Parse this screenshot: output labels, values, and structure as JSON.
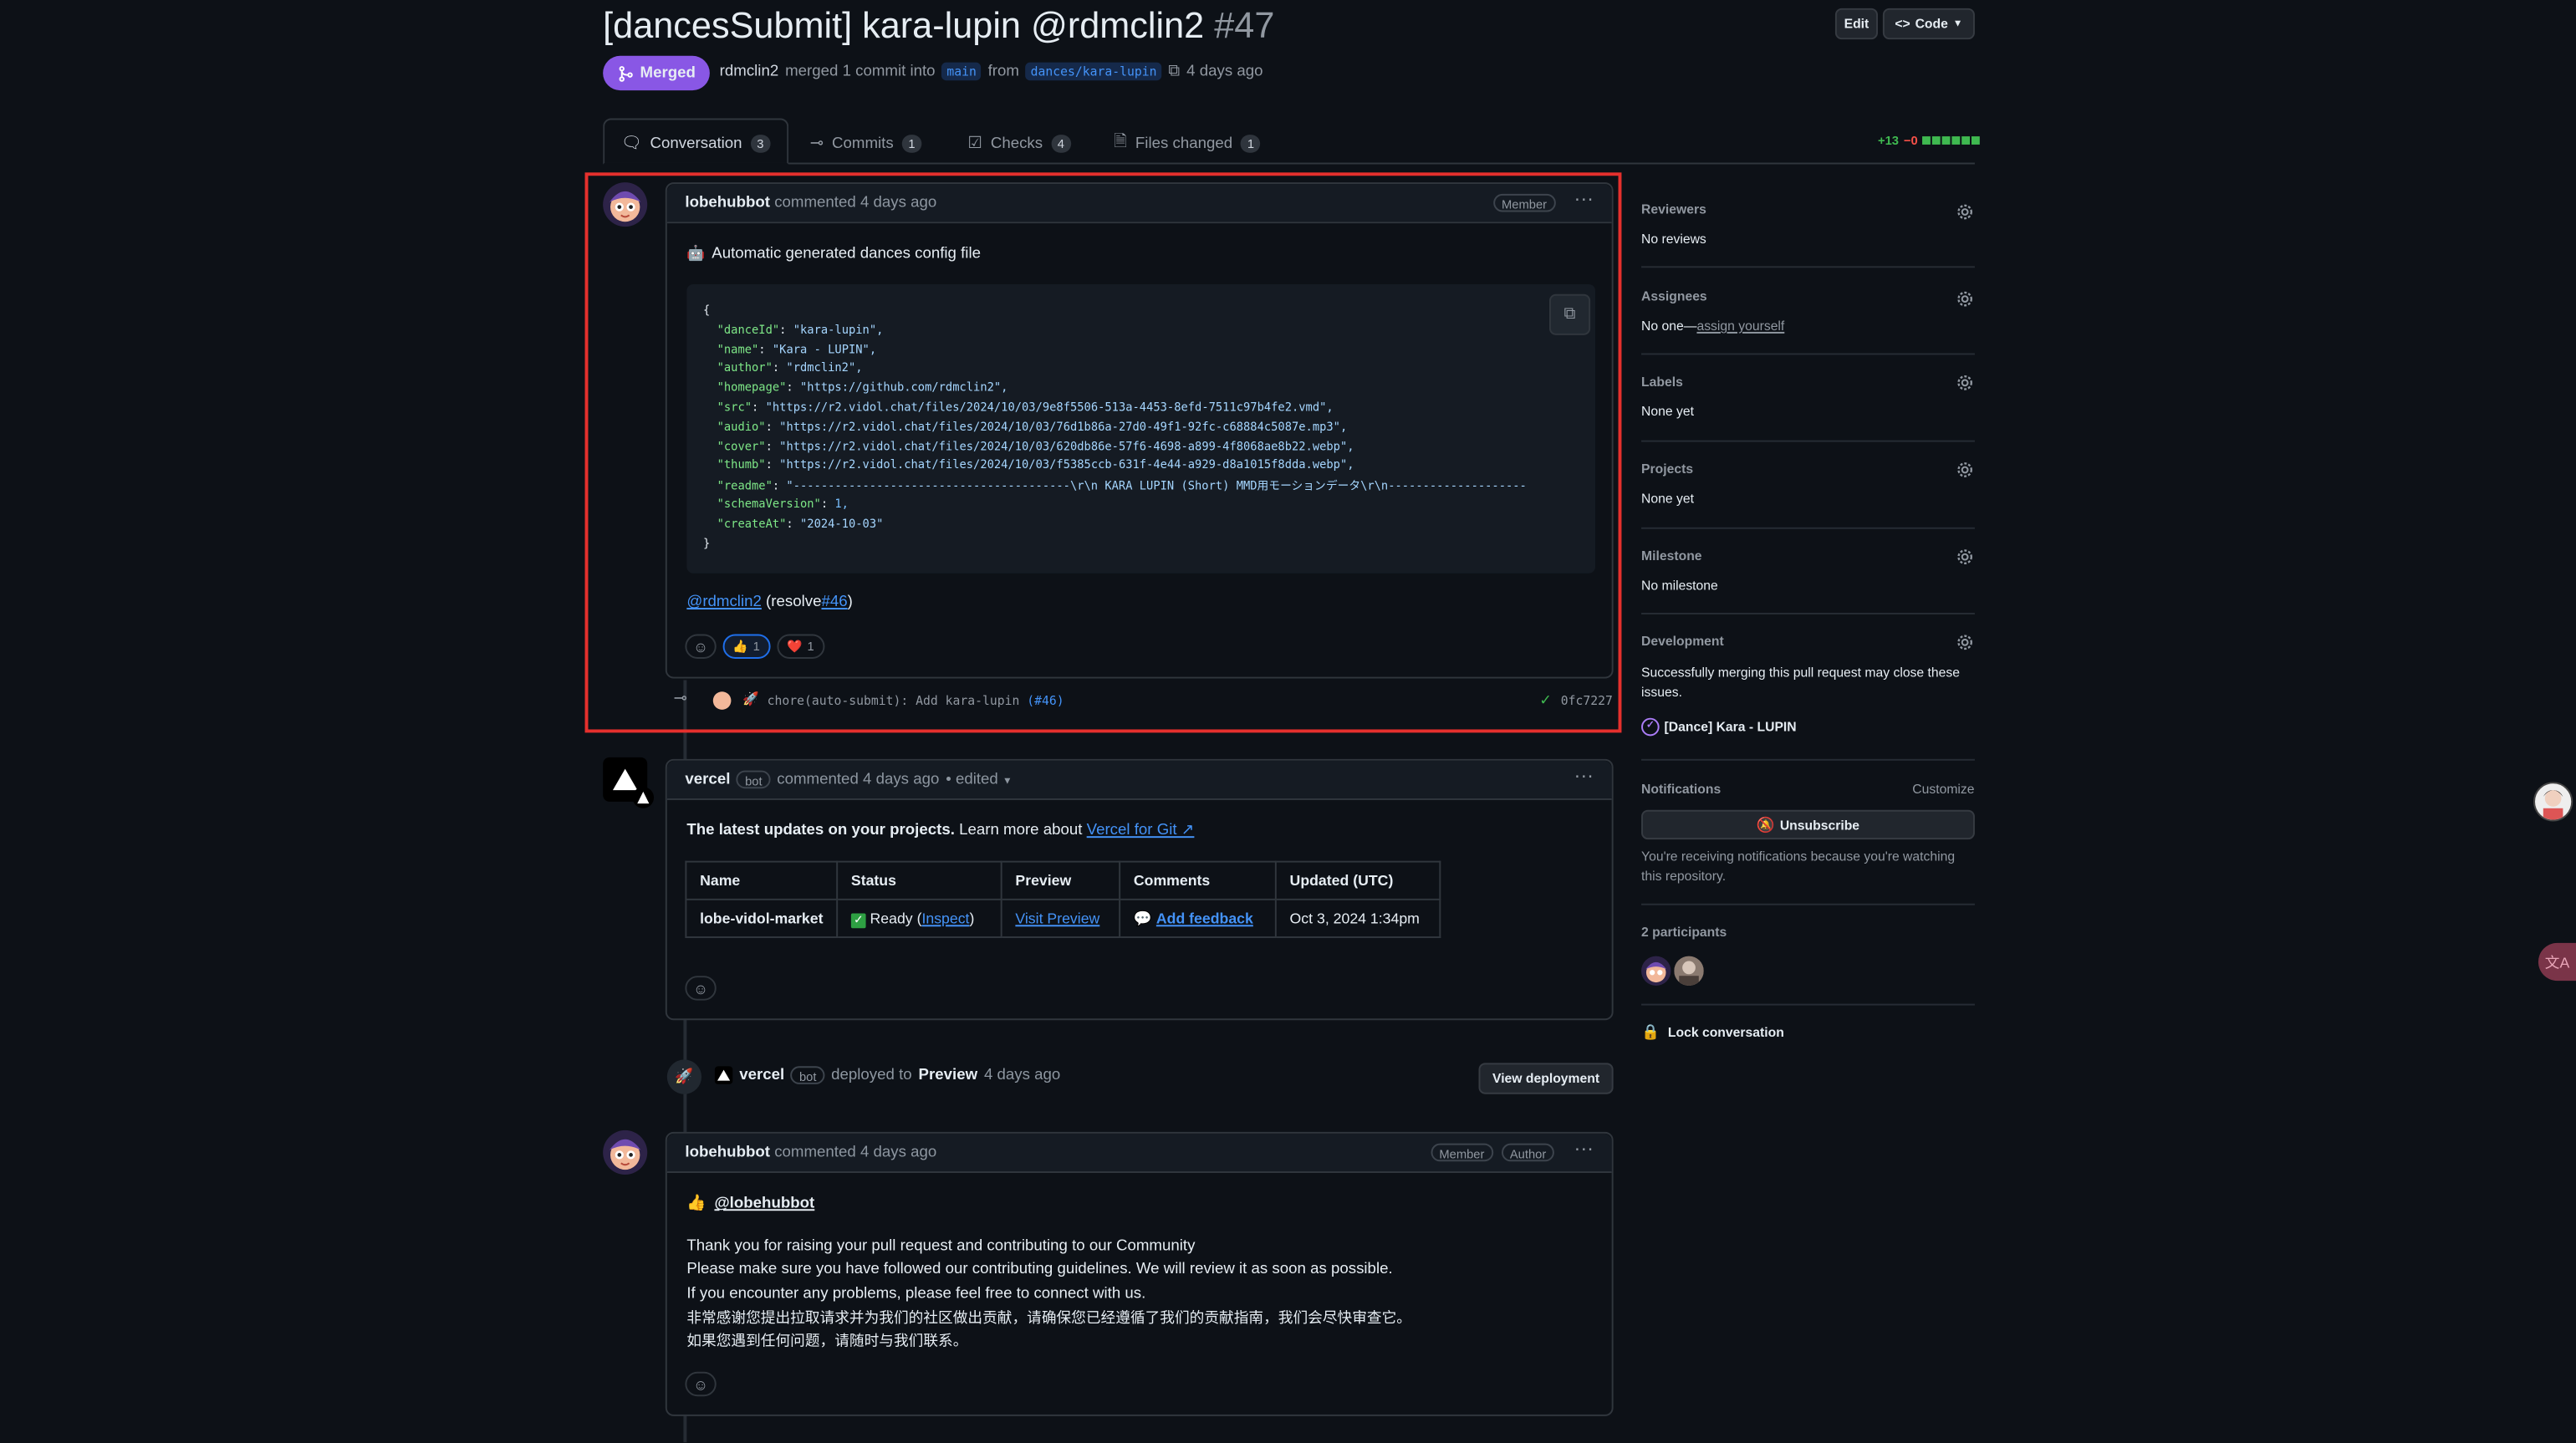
{
  "pr": {
    "title": "[dancesSubmit] kara-lupin @rdmclin2",
    "number": "#47",
    "state": "Merged",
    "author": "rdmclin2",
    "merged_text": "merged 1 commit into",
    "base_branch": "main",
    "from_text": "from",
    "head_branch": "dances/kara-lupin",
    "time": "4 days ago",
    "edit_label": "Edit",
    "code_label": "Code"
  },
  "tabs": [
    {
      "label": "Conversation",
      "count": "3"
    },
    {
      "label": "Commits",
      "count": "1"
    },
    {
      "label": "Checks",
      "count": "4"
    },
    {
      "label": "Files changed",
      "count": "1"
    }
  ],
  "diffstat": {
    "additions": "+13",
    "deletions": "−0"
  },
  "comment1": {
    "author": "lobehubbot",
    "action": "commented 4 days ago",
    "badge": "Member",
    "intro": "Automatic generated dances config file",
    "code_lines": [
      "{",
      "  \"danceId\": \"kara-lupin\",",
      "  \"name\": \"Kara - LUPIN\",",
      "  \"author\": \"rdmclin2\",",
      "  \"homepage\": \"https://github.com/rdmclin2\",",
      "  \"src\": \"https://r2.vidol.chat/files/2024/10/03/9e8f5506-513a-4453-8efd-7511c97b4fe2.vmd\",",
      "  \"audio\": \"https://r2.vidol.chat/files/2024/10/03/76d1b86a-27d0-49f1-92fc-c68884c5087e.mp3\",",
      "  \"cover\": \"https://r2.vidol.chat/files/2024/10/03/620db86e-57f6-4698-a899-4f8068ae8b22.webp\",",
      "  \"thumb\": \"https://r2.vidol.chat/files/2024/10/03/f5385ccb-631f-4e44-a929-d8a1015f8dda.webp\",",
      "  \"readme\": \"----------------------------------------\\r\\n KARA LUPIN (Short) MMD用モーションデータ\\r\\n--------------------",
      "  \"schemaVersion\": 1,",
      "  \"createAt\": \"2024-10-03\"",
      "}"
    ],
    "mention": "@rdmclin2",
    "resolve_prefix": "(resolve",
    "resolve_link": "#46",
    "resolve_suffix": ")",
    "reactions": [
      {
        "emoji": "👍",
        "count": "1"
      },
      {
        "emoji": "❤️",
        "count": "1"
      }
    ]
  },
  "commit": {
    "message": "chore(auto-submit): Add kara-lupin",
    "ref": "(#46)",
    "sha": "0fc7227"
  },
  "comment2": {
    "author": "vercel",
    "bot_label": "bot",
    "action": "commented 4 days ago",
    "edited": "• edited",
    "heading_bold": "The latest updates on your projects.",
    "heading_rest": "Learn more about",
    "heading_link": "Vercel for Git ↗",
    "table_headers": [
      "Name",
      "Status",
      "Preview",
      "Comments",
      "Updated (UTC)"
    ],
    "table_row": {
      "name": "lobe-vidol-market",
      "status": "Ready",
      "inspect": "Inspect",
      "preview": "Visit Preview",
      "comments": "Add feedback",
      "updated": "Oct 3, 2024 1:34pm"
    }
  },
  "deploy": {
    "actor": "vercel",
    "bot_label": "bot",
    "text": "deployed to",
    "env": "Preview",
    "time": "4 days ago",
    "button": "View deployment"
  },
  "comment3": {
    "author": "lobehubbot",
    "action": "commented 4 days ago",
    "badge_member": "Member",
    "badge_author": "Author",
    "mention": "@lobehubbot",
    "lines": [
      "Thank you for raising your pull request and contributing to our Community",
      "Please make sure you have followed our contributing guidelines. We will review it as soon as possible.",
      "If you encounter any problems, please feel free to connect with us.",
      "非常感谢您提出拉取请求并为我们的社区做出贡献，请确保您已经遵循了我们的贡献指南，我们会尽快审查它。",
      "如果您遇到任何问题，请随时与我们联系。"
    ]
  },
  "sidebar": {
    "reviewers_title": "Reviewers",
    "reviewers_value": "No reviews",
    "assignees_title": "Assignees",
    "assignees_value": "No one—",
    "assignees_link": "assign yourself",
    "labels_title": "Labels",
    "labels_value": "None yet",
    "projects_title": "Projects",
    "projects_value": "None yet",
    "milestone_title": "Milestone",
    "milestone_value": "No milestone",
    "development_title": "Development",
    "development_text": "Successfully merging this pull request may close these issues.",
    "development_issue": "[Dance] Kara - LUPIN",
    "notifications_title": "Notifications",
    "customize_label": "Customize",
    "unsubscribe_label": "Unsubscribe",
    "notifications_note": "You're receiving notifications because you're watching this repository.",
    "participants_title": "2 participants",
    "lock_label": "Lock conversation"
  },
  "colors": {
    "merged_purple": "#8957e5",
    "highlight_red": "#e5302d",
    "link_blue": "#4493f8",
    "success_green": "#3fb950"
  }
}
